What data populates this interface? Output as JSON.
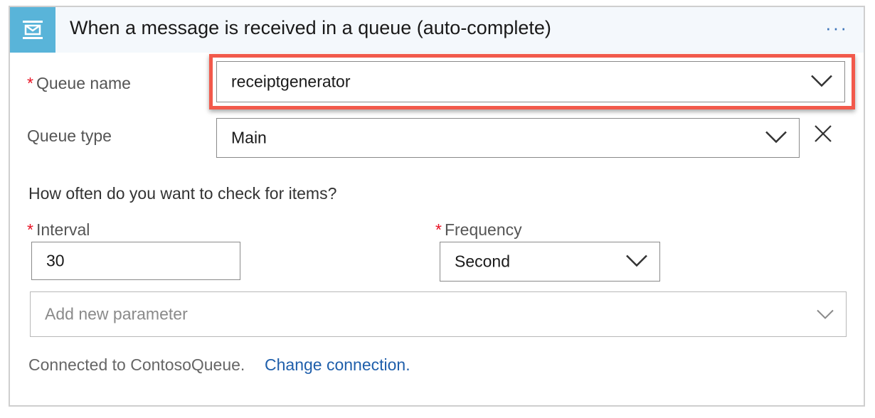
{
  "header": {
    "title": "When a message is received in a queue (auto-complete)",
    "more_label": "···",
    "icon": "service-bus-queue-icon"
  },
  "fields": {
    "queue_name": {
      "required_mark": "*",
      "label": "Queue name",
      "value": "receiptgenerator"
    },
    "queue_type": {
      "label": "Queue type",
      "value": "Main"
    },
    "check_question": "How often do you want to check for items?",
    "interval": {
      "required_mark": "*",
      "label": "Interval",
      "value": "30"
    },
    "frequency": {
      "required_mark": "*",
      "label": "Frequency",
      "value": "Second"
    },
    "add_parameter": {
      "placeholder": "Add new parameter"
    }
  },
  "connection": {
    "status": "Connected to ContosoQueue.",
    "change_link": "Change connection."
  },
  "colors": {
    "header_icon_bg": "#59b4d9",
    "highlight": "#f2594b",
    "required": "#e81123",
    "link": "#1f5fab"
  }
}
